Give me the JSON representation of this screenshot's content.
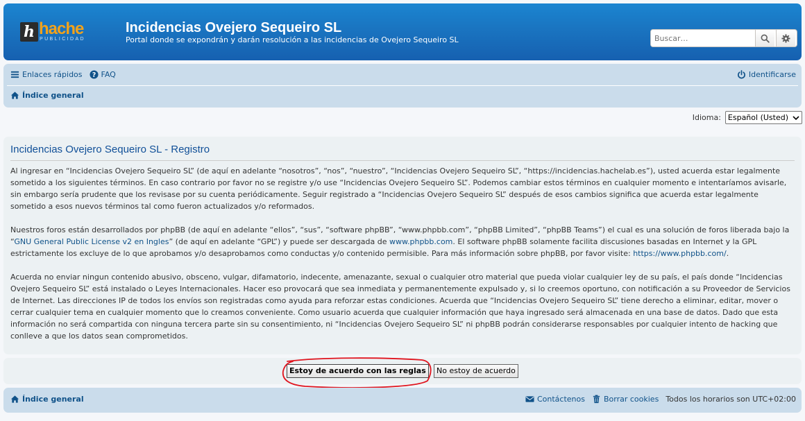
{
  "header": {
    "logo_letter": "h",
    "logo_word": "hache",
    "logo_sub": "PUBLICIDAD",
    "site_title": "Incidencias Ovejero Sequeiro SL",
    "site_description": "Portal donde se expondrán y darán resolución a las incidencias de Ovejero Sequeiro SL",
    "search_placeholder": "Buscar…"
  },
  "navbar": {
    "quick_links": "Enlaces rápidos",
    "faq": "FAQ",
    "login": "Identificarse",
    "breadcrumb": "Índice general"
  },
  "language": {
    "label": "Idioma:",
    "selected": "Español (Usted)"
  },
  "panel": {
    "title": "Incidencias Ovejero Sequeiro SL - Registro",
    "p1": "Al ingresar en “Incidencias Ovejero Sequeiro SL” (de aquí en adelante “nosotros”, “nos”, “nuestro”, “Incidencias Ovejero Sequeiro SL”, “https://incidencias.hachelab.es”), usted acuerda estar legalmente sometido a los siguientes términos. En caso contrario por favor no se registre y/o use “Incidencias Ovejero Sequeiro SL”. Podemos cambiar estos términos en cualquier momento e intentaríamos avisarle, sin embargo sería prudente que los revisase por su cuenta periódicamente. Seguir registrado a “Incidencias Ovejero Sequeiro SL” después de esos cambios significa que acuerda estar legalmente sometido a esos nuevos términos tal como fueron actualizados y/o reformados.",
    "p2_a": "Nuestros foros están desarrollados por phpBB (de aquí en adelante “ellos”, “sus”, “software phpBB”, “www.phpbb.com”, “phpBB Limited”, “phpBB Teams”) el cual es una solución de foros liberada bajo la “",
    "p2_link1": "GNU General Public License v2 en Ingles",
    "p2_b": "” (de aquí en adelante “GPL”) y puede ser descargada de ",
    "p2_link2": "www.phpbb.com",
    "p2_c": ". El software phpBB solamente facilita discusiones basadas en Internet y la GPL estrictamente los excluye de lo que aprobamos y/o desaprobamos como conductas y/o contenido permisible. Para más información sobre phpBB, por favor visite: ",
    "p2_link3": "https://www.phpbb.com/",
    "p2_d": ".",
    "p3": "Acuerda no enviar ningun contenido abusivo, obsceno, vulgar, difamatorio, indecente, amenazante, sexual o cualquier otro material que pueda violar cualquier ley de su país, el país donde “Incidencias Ovejero Sequeiro SL” está instalado o Leyes Internacionales. Hacer eso provocará que sea inmediata y permanentemente expulsado y, si lo creemos oportuno, con notificación a su Proveedor de Servicios de Internet. Las direcciones IP de todos los envíos son registradas como ayuda para reforzar estas condiciones. Acuerda que “Incidencias Ovejero Sequeiro SL” tiene derecho a eliminar, editar, mover o cerrar cualquier tema en cualquier momento que lo creamos conveniente. Como usuario acuerda que cualquier información que haya ingresado será almacenada en una base de datos. Dado que esta información no será compartida con ninguna tercera parte sin su consentimiento, ni “Incidencias Ovejero Sequeiro SL” ni phpBB podrán considerarse responsables por cualquier intento de hacking que conlleve a que los datos sean comprometidos."
  },
  "actions": {
    "agree": "Estoy de acuerdo con las reglas",
    "disagree": "No estoy de acuerdo"
  },
  "footer": {
    "breadcrumb": "Índice general",
    "contact": "Contáctenos",
    "delete_cookies": "Borrar cookies",
    "timezone": "Todos los horarios son UTC+02:00"
  },
  "colors": {
    "header": "#1a76c2",
    "navbar": "#cadceb",
    "panel": "#ecf1f3",
    "link": "#105289",
    "annotation": "#e0141e"
  }
}
